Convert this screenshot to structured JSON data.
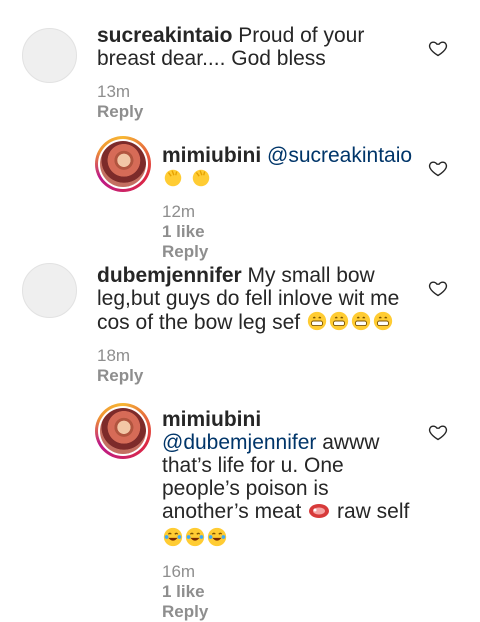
{
  "comments": [
    {
      "username": "sucreakintaio",
      "text": "Proud of your breast dear.... God bless",
      "time": "13m",
      "reply_label": "Reply"
    },
    {
      "username": "mimiubini",
      "mention": "@sucreakintaio",
      "emojis": "clap-hands x2",
      "time": "12m",
      "likes": "1 like",
      "reply_label": "Reply"
    },
    {
      "username": "dubemjennifer",
      "text": "My small bow leg,but guys do fell inlove wit me cos of the bow leg sef",
      "emojis": "grin x4",
      "time": "18m",
      "reply_label": "Reply"
    },
    {
      "username": "mimiubini",
      "mention": "@dubemjennifer",
      "text_a": "awww that’s life for u. One people’s poison is another’s meat",
      "text_b": "raw self",
      "emojis": "meat x1, laugh-tears x3",
      "time": "16m",
      "likes": "1 like",
      "reply_label": "Reply"
    }
  ],
  "colors": {
    "text": "#262626",
    "meta": "#8e8e8e",
    "mention": "#003569",
    "story_ring": "#dc2743"
  }
}
